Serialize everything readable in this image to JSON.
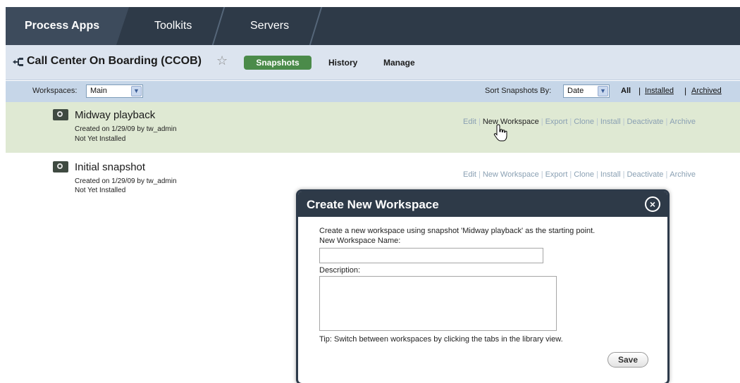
{
  "nav": {
    "tabs": [
      {
        "label": "Process Apps",
        "active": true
      },
      {
        "label": "Toolkits",
        "active": false
      },
      {
        "label": "Servers",
        "active": false
      }
    ]
  },
  "app": {
    "title": "Call Center On Boarding (CCOB)",
    "subtabs": [
      "Snapshots",
      "History",
      "Manage"
    ],
    "active_subtab": "Snapshots"
  },
  "filter": {
    "workspaces_label": "Workspaces:",
    "workspace_value": "Main",
    "sort_label": "Sort Snapshots By:",
    "sort_value": "Date",
    "views": [
      "All",
      "Installed",
      "Archived"
    ]
  },
  "snapshots": [
    {
      "name": "Midway playback",
      "created": "Created on 1/29/09 by tw_admin",
      "status": "Not Yet Installed"
    },
    {
      "name": "Initial snapshot",
      "created": "Created on 1/29/09 by tw_admin",
      "status": "Not Yet Installed"
    }
  ],
  "actions": [
    "Edit",
    "New Workspace",
    "Export",
    "Clone",
    "Install",
    "Deactivate",
    "Archive"
  ],
  "dialog": {
    "title": "Create New Workspace",
    "intro": "Create a new workspace using snapshot 'Midway playback' as the starting point.",
    "name_label": "New Workspace Name:",
    "name_value": "",
    "description_label": "Description:",
    "description_value": "",
    "tip": "Tip: Switch between workspaces by clicking the tabs in the library view.",
    "save_label": "Save"
  },
  "colors": {
    "nav_bg": "#2e3a48",
    "active_tab_bg": "#3d4b5c",
    "app_header_bg": "#dce4ef",
    "filter_bar_bg": "#c6d6e8",
    "selected_row_bg": "#dfe9d3",
    "snapshots_pill": "#4b8b4a"
  },
  "icons": [
    "app-tree-icon",
    "star-icon",
    "camera-icon",
    "hand-cursor-icon",
    "close-icon",
    "chevron-down-icon"
  ]
}
